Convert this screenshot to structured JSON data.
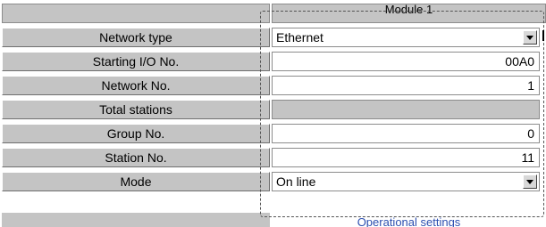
{
  "header": {
    "module_label": "Module 1"
  },
  "rows": [
    {
      "label": "Network type",
      "value": "Ethernet",
      "kind": "select"
    },
    {
      "label": "Starting I/O No.",
      "value": "00A0",
      "kind": "number"
    },
    {
      "label": "Network No.",
      "value": "1",
      "kind": "number"
    },
    {
      "label": "Total stations",
      "value": "",
      "kind": "disabled"
    },
    {
      "label": "Group No.",
      "value": "0",
      "kind": "number"
    },
    {
      "label": "Station No.",
      "value": "11",
      "kind": "number"
    },
    {
      "label": "Mode",
      "value": "On line",
      "kind": "select"
    }
  ],
  "footer": {
    "link_label": "Operational settings"
  },
  "icons": {
    "dropdown": "chevron-down-icon"
  },
  "colors": {
    "label_bg": "#c4c4c4",
    "cell_bg": "#ffffff",
    "link": "#2c4fb0"
  }
}
